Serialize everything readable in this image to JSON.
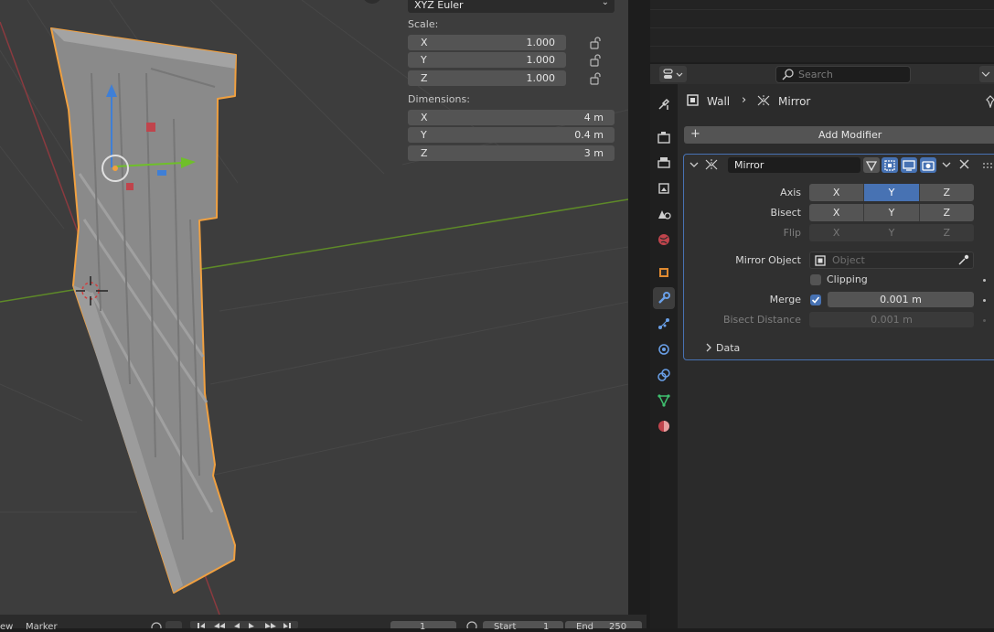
{
  "viewport": {
    "rotation_mode": "XYZ Euler",
    "scale_label": "Scale:",
    "scale": [
      {
        "axis": "X",
        "value": "1.000"
      },
      {
        "axis": "Y",
        "value": "1.000"
      },
      {
        "axis": "Z",
        "value": "1.000"
      }
    ],
    "dimensions_label": "Dimensions:",
    "dimensions": [
      {
        "axis": "X",
        "value": "4 m"
      },
      {
        "axis": "Y",
        "value": "0.4 m"
      },
      {
        "axis": "Z",
        "value": "3 m"
      }
    ]
  },
  "timeline": {
    "view_label": "ew",
    "marker_label": "Marker",
    "current_frame": "1",
    "start_label": "Start",
    "start_value": "1",
    "end_label": "End",
    "end_value": "250"
  },
  "properties": {
    "search_placeholder": "Search",
    "breadcrumb_object": "Wall",
    "breadcrumb_modifier": "Mirror",
    "add_modifier_label": "Add Modifier",
    "modifier": {
      "name": "Mirror",
      "axis_label": "Axis",
      "bisect_label": "Bisect",
      "flip_label": "Flip",
      "axes": [
        "X",
        "Y",
        "Z"
      ],
      "axis_selected": "Y",
      "mirror_object_label": "Mirror Object",
      "mirror_object_placeholder": "Object",
      "clipping_label": "Clipping",
      "clipping_checked": false,
      "merge_label": "Merge",
      "merge_checked": true,
      "merge_value": "0.001 m",
      "bisect_distance_label": "Bisect Distance",
      "bisect_distance_value": "0.001 m",
      "data_label": "Data"
    }
  },
  "colors": {
    "accent": "#4772b3",
    "selection_outline": "#f0a040"
  }
}
